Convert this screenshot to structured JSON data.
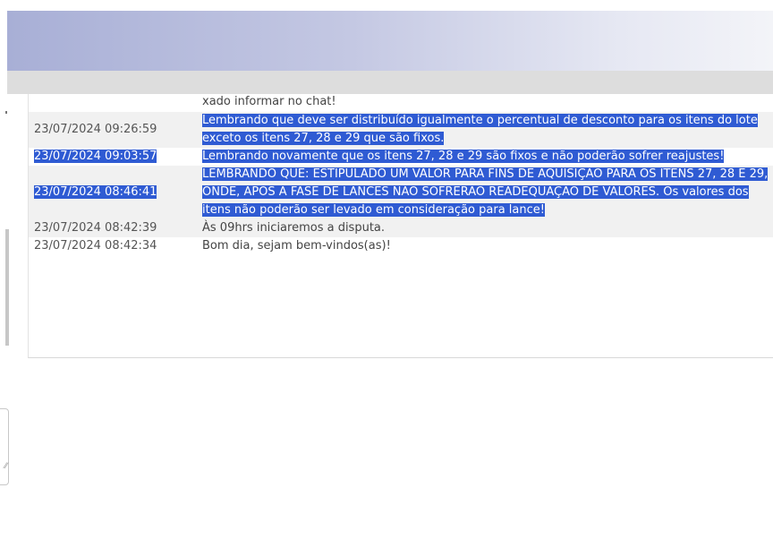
{
  "chat": {
    "messages": [
      {
        "time": "",
        "text": "xado informar no chat!",
        "partial": true
      },
      {
        "time": "23/07/2024 09:26:59",
        "text": "Lembrando que deve ser distribuído igualmente o percentual de desconto para os itens do lote exceto os itens 27, 28 e 29 que são fixos.",
        "selected_text": true,
        "selected_time": false
      },
      {
        "time": "23/07/2024 09:03:57",
        "text": "Lembrando novamente que os itens 27, 28 e 29 são fixos e não poderão sofrer reajustes!",
        "selected_text": true,
        "selected_time": true
      },
      {
        "time": "23/07/2024 08:46:41",
        "text": "LEMBRANDO QUE: ESTIPULADO UM VALOR PARA FINS DE AQUISIÇÃO PARA OS ITENS 27, 28 E 29, ONDE, APÓS A FASE DE LANCES NÃO SOFRERÃO READEQUAÇÃO DE VALORES. Os valores dos itens não poderão ser levado em consideração para lance!",
        "selected_text": true,
        "selected_time": true
      },
      {
        "time": "23/07/2024 08:42:39",
        "text": "Às 09hrs iniciaremos a disputa.",
        "selected_text": false,
        "selected_time": false
      },
      {
        "time": "23/07/2024 08:42:34",
        "text": "Bom dia, sejam bem-vindos(as)!",
        "selected_text": false,
        "selected_time": false
      }
    ]
  },
  "colors": {
    "selection": "#2f5bd3",
    "row_alt": "#f1f1f1",
    "banner_start": "#a8afd6",
    "toolbar": "#dddddd"
  }
}
